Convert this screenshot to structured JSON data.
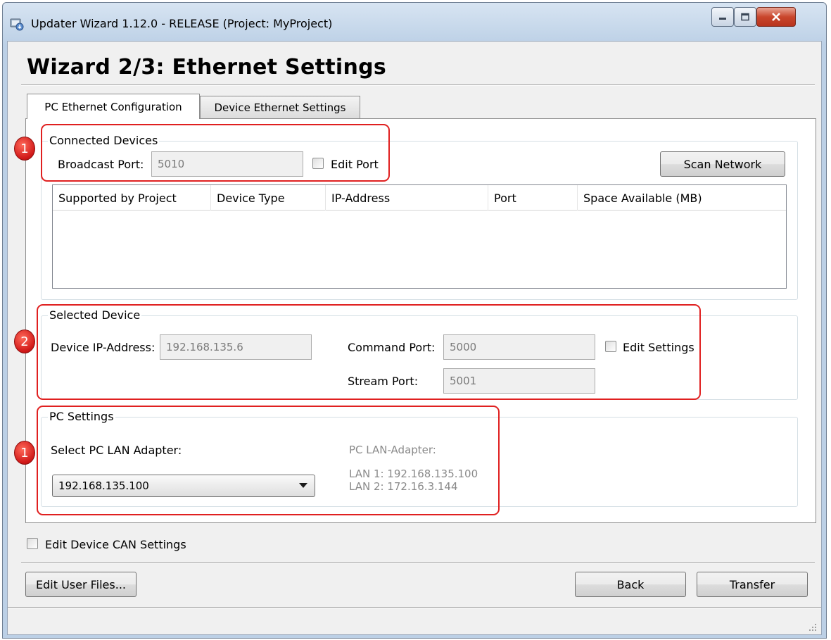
{
  "window": {
    "title": "Updater Wizard 1.12.0 - RELEASE (Project: MyProject)"
  },
  "page": {
    "heading": "Wizard 2/3:   Ethernet Settings"
  },
  "tabs": [
    {
      "label": "PC Ethernet Configuration",
      "active": true
    },
    {
      "label": "Device Ethernet Settings",
      "active": false
    }
  ],
  "connected_devices": {
    "title": "Connected Devices",
    "broadcast_port_label": "Broadcast Port:",
    "broadcast_port_value": "5010",
    "edit_port_label": "Edit Port",
    "scan_button": "Scan Network",
    "table_columns": [
      "Supported by Project",
      "Device Type",
      "IP-Address",
      "Port",
      "Space Available (MB)"
    ]
  },
  "selected_device": {
    "title": "Selected Device",
    "ip_label": "Device IP-Address:",
    "ip_value": "192.168.135.6",
    "command_port_label": "Command  Port:",
    "command_port_value": "5000",
    "stream_port_label": "Stream Port:",
    "stream_port_value": "5001",
    "edit_settings_label": "Edit Settings"
  },
  "pc_settings": {
    "title": "PC Settings",
    "select_label": "Select PC LAN Adapter:",
    "selected_adapter": "192.168.135.100",
    "adapter_header": "PC LAN-Adapter:",
    "adapters": [
      "LAN 1: 192.168.135.100",
      "LAN 2: 172.16.3.144"
    ]
  },
  "options": {
    "edit_can_label": "Edit Device CAN Settings"
  },
  "buttons": {
    "edit_user_files": "Edit User Files...",
    "back": "Back",
    "transfer": "Transfer"
  },
  "callouts": [
    "1",
    "2",
    "1"
  ],
  "colors": {
    "callout_red": "#e02020",
    "titlebar_blue": "#bcd0e6",
    "close_red": "#c9462c"
  },
  "icons": {
    "app": "updater-app-icon",
    "minimize": "minimize-icon",
    "maximize": "maximize-icon",
    "close": "close-icon",
    "dropdown": "chevron-down-icon",
    "resize": "resize-grip-icon"
  }
}
